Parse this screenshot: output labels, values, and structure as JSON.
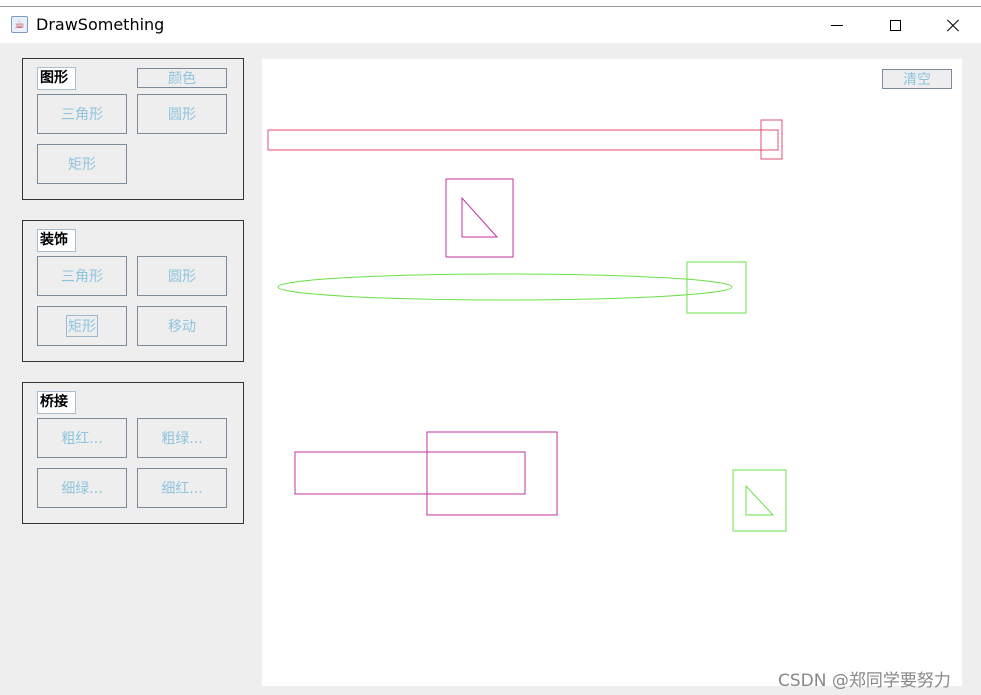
{
  "window": {
    "title": "DrawSomething",
    "app_icon": "java-cup-icon"
  },
  "panels": [
    {
      "label": "图形",
      "buttons": [
        "三角形",
        "圆形",
        "矩形"
      ],
      "color_button": "颜色"
    },
    {
      "label": "装饰",
      "buttons": [
        "三角形",
        "圆形",
        "矩形",
        "移动"
      ]
    },
    {
      "label": "桥接",
      "buttons": [
        "粗红...",
        "粗绿...",
        "细绿...",
        "细红..."
      ]
    }
  ],
  "canvas": {
    "clear_label": "清空"
  },
  "colors": {
    "red": "#e05070",
    "magenta": "#c030a0",
    "green": "#6ce04a",
    "button_text": "#8fc4dc"
  },
  "watermark": "CSDN @郑同学要努力"
}
